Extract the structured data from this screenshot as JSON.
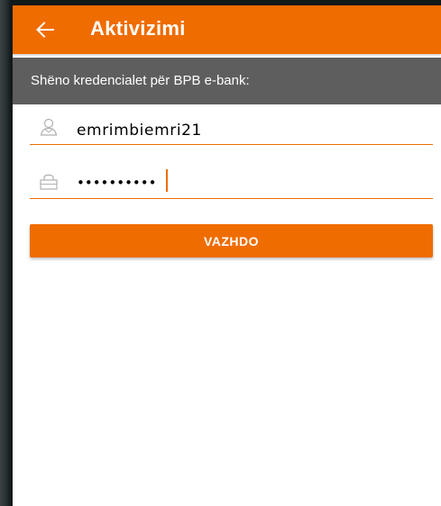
{
  "app_bar": {
    "title": "Aktivizimi",
    "back_icon": "arrow-left-icon",
    "color": "#ef6c00"
  },
  "subheader": {
    "text": "Shëno kredencialet për BPB e-bank:",
    "color": "#5e5e5e"
  },
  "form": {
    "username": {
      "icon": "user-icon",
      "value": "emrimbiemri21"
    },
    "password": {
      "icon": "lock-icon",
      "value": "••••••••••"
    },
    "submit_label": "VAZHDO"
  }
}
